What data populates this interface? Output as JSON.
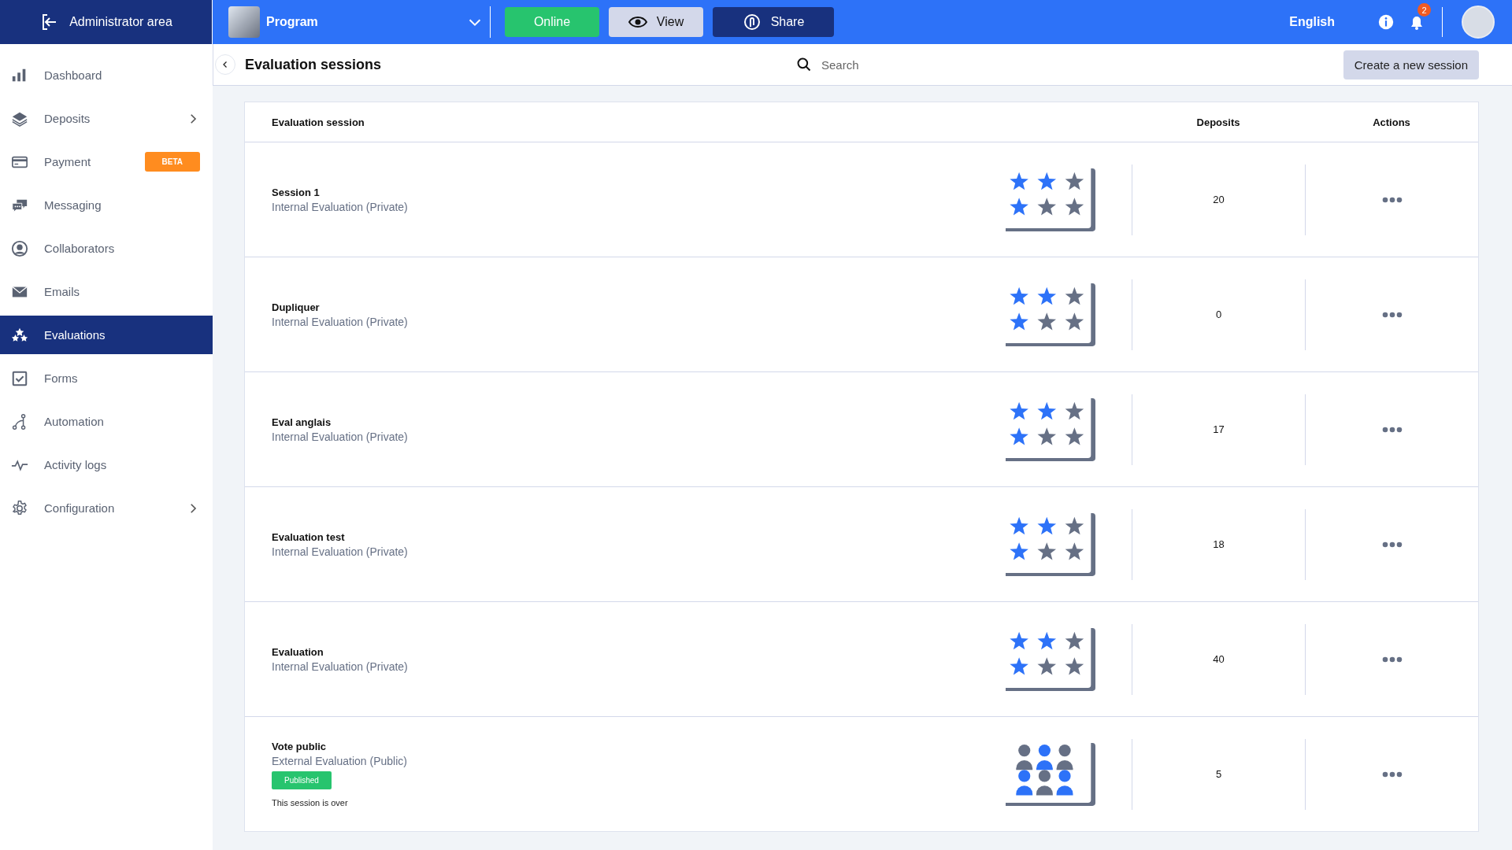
{
  "top_bar": {
    "admin_link": "Administrator area",
    "program": {
      "name": "Program"
    },
    "status_button": "Online",
    "view_button": "View",
    "share_button": "Share",
    "language": "English",
    "notification_count": "2"
  },
  "sidebar": {
    "items": [
      {
        "label": "Dashboard",
        "selected": false,
        "has_submenu": false
      },
      {
        "label": "Deposits",
        "selected": false,
        "has_submenu": true
      },
      {
        "label": "Payment",
        "selected": false,
        "has_submenu": false,
        "badge": "BETA"
      },
      {
        "label": "Messaging",
        "selected": false,
        "has_submenu": false
      },
      {
        "label": "Collaborators",
        "selected": false,
        "has_submenu": false
      },
      {
        "label": "Emails",
        "selected": false,
        "has_submenu": false
      },
      {
        "label": "Evaluations",
        "selected": true,
        "has_submenu": false
      },
      {
        "label": "Forms",
        "selected": false,
        "has_submenu": false
      },
      {
        "label": "Automation",
        "selected": false,
        "has_submenu": false
      },
      {
        "label": "Activity logs",
        "selected": false,
        "has_submenu": false
      },
      {
        "label": "Configuration",
        "selected": false,
        "has_submenu": true
      }
    ]
  },
  "page": {
    "title": "Evaluation sessions",
    "search": {
      "placeholder": "Search"
    },
    "create_button": "Create a new session"
  },
  "table": {
    "columns": [
      "Evaluation session",
      "Deposits",
      "Actions"
    ],
    "rows": [
      {
        "name": "Session 1",
        "type": "Internal Evaluation (Private)",
        "kind": "rating",
        "deposits": "20"
      },
      {
        "name": "Dupliquer",
        "type": "Internal Evaluation (Private)",
        "kind": "rating",
        "deposits": "0"
      },
      {
        "name": "Eval anglais",
        "type": "Internal Evaluation (Private)",
        "kind": "rating",
        "deposits": "17"
      },
      {
        "name": "Evaluation test",
        "type": "Internal Evaluation (Private)",
        "kind": "rating",
        "deposits": "18"
      },
      {
        "name": "Evaluation",
        "type": "Internal Evaluation (Private)",
        "kind": "rating",
        "deposits": "40"
      },
      {
        "name": "Vote public",
        "type": "External Evaluation (Public)",
        "kind": "vote",
        "status": "Published",
        "note": "This session is over",
        "deposits": "5"
      }
    ]
  }
}
